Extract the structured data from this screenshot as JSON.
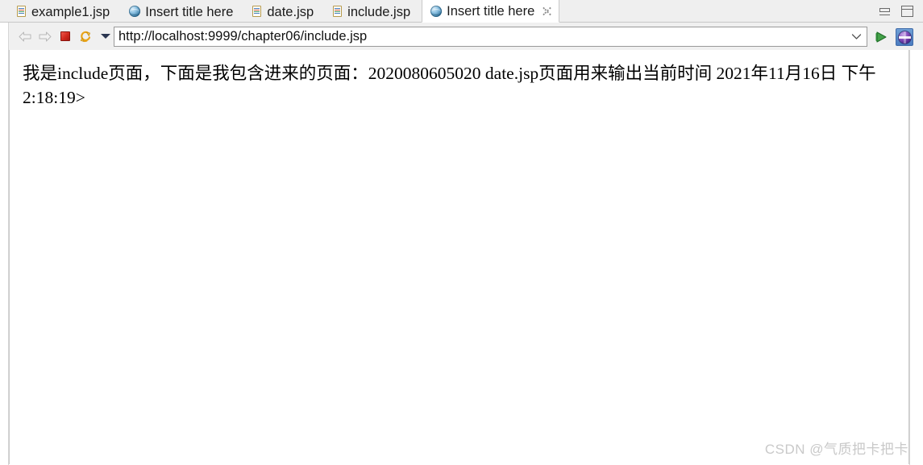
{
  "window": {
    "minimize_tooltip": "Minimize",
    "maximize_tooltip": "Maximize"
  },
  "tabs": [
    {
      "label": "example1.jsp",
      "icon": "file-icon",
      "active": false,
      "closable": false
    },
    {
      "label": "Insert title here",
      "icon": "globe-icon",
      "active": false,
      "closable": false
    },
    {
      "label": "date.jsp",
      "icon": "file-icon",
      "active": false,
      "closable": false
    },
    {
      "label": "include.jsp",
      "icon": "file-icon",
      "active": false,
      "closable": false
    },
    {
      "label": "Insert title here",
      "icon": "globe-icon",
      "active": true,
      "closable": true
    }
  ],
  "toolbar": {
    "back_icon": "arrow-left-icon",
    "forward_icon": "arrow-right-icon",
    "stop_icon": "stop-icon",
    "refresh_icon": "refresh-icon",
    "history_dropdown_icon": "chevron-down-icon",
    "go_icon": "play-go-icon",
    "open_external_browser_icon": "globe-button-icon"
  },
  "address": {
    "url": "http://localhost:9999/chapter06/include.jsp",
    "placeholder": "http://",
    "dropdown_icon": "chevron-down-icon"
  },
  "page": {
    "body_text": "我是include页面，下面是我包含进来的页面：2020080605020 date.jsp页面用来输出当前时间 2021年11月16日 下午2:18:19>"
  },
  "watermark": {
    "text": "CSDN @气质把卡把卡"
  },
  "colors": {
    "tabbar_bg": "#efefef",
    "toolbar_bg": "#f0f0f0",
    "active_tab_bg": "#ffffff",
    "border": "#c8c8c8",
    "stop_red": "#d12a1e",
    "go_green": "#2e9b3e",
    "globe_blue": "#4b7cc0",
    "watermark_grey": "#c9c9c9",
    "text": "#000000"
  }
}
